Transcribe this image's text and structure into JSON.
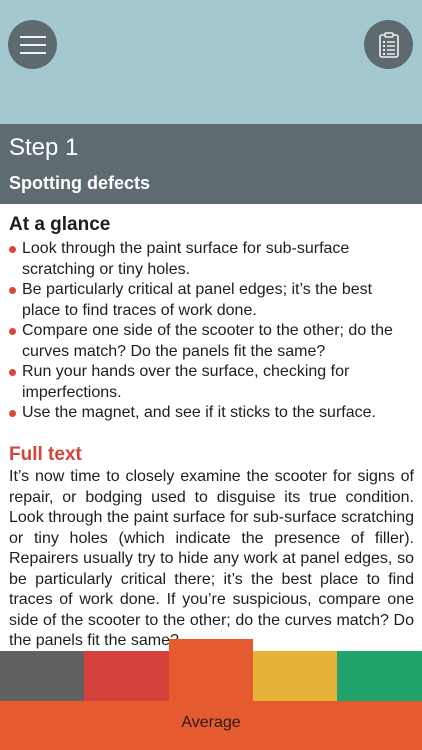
{
  "header": {
    "menu_icon": "hamburger-menu-icon",
    "clipboard_icon": "clipboard-checklist-icon"
  },
  "step": {
    "title": "Step 1",
    "subtitle": "Spotting defects"
  },
  "at_a_glance": {
    "heading": "At a glance",
    "items": [
      "Look through the paint surface for sub-surface scratching or tiny holes.",
      "Be particularly critical at panel edges; it’s the best place to find traces of work done.",
      "Compare one side of the scooter to the other; do the curves match? Do the panels fit the same?",
      "Run your hands over the surface, checking for imperfections.",
      "Use the magnet, and see if it sticks to the surface."
    ]
  },
  "full_text": {
    "heading": "Full text",
    "body": "It’s now time to closely examine the scooter for signs of repair, or bodging used to disguise its true condition. Look through the paint surface for sub-surface scratching or tiny holes (which indicate the presence of filler). Repairers usually try to hide any work at panel edges, so be particularly critical there; it’s the best place to find traces of work done. If you’re suspicious, compare one side of the scooter to the other; do the curves match? Do the panels fit the same?"
  },
  "rating": {
    "selected_label": "Average",
    "selected_index": 2,
    "colors": [
      "#616161",
      "#d5403a",
      "#e55a2f",
      "#e7b23a",
      "#21a46b"
    ]
  }
}
